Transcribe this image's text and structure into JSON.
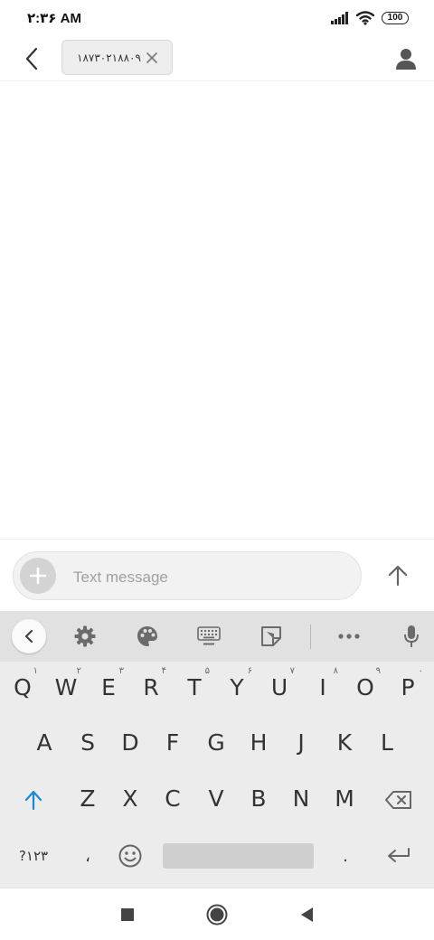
{
  "status_bar": {
    "time": "۲:۳۶ AM",
    "battery": "100"
  },
  "conversation": {
    "recipient": "۱۸۷۳۰۲۱۸۸۰۹"
  },
  "compose": {
    "placeholder": "Text message"
  },
  "keyboard": {
    "row1": [
      {
        "key": "Q",
        "hint": "۱"
      },
      {
        "key": "W",
        "hint": "۲"
      },
      {
        "key": "E",
        "hint": "۳"
      },
      {
        "key": "R",
        "hint": "۴"
      },
      {
        "key": "T",
        "hint": "۵"
      },
      {
        "key": "Y",
        "hint": "۶"
      },
      {
        "key": "U",
        "hint": "۷"
      },
      {
        "key": "I",
        "hint": "۸"
      },
      {
        "key": "O",
        "hint": "۹"
      },
      {
        "key": "P",
        "hint": "۰"
      }
    ],
    "row2": [
      "A",
      "S",
      "D",
      "F",
      "G",
      "H",
      "J",
      "K",
      "L"
    ],
    "row3": [
      "Z",
      "X",
      "C",
      "V",
      "B",
      "N",
      "M"
    ],
    "symbols_key": "?۱۲۳",
    "comma_key": "،",
    "period_key": "."
  },
  "icons": {
    "back": "back-arrow-icon",
    "chip_close": "close-icon",
    "contact": "person-icon",
    "attach": "plus-icon",
    "send": "arrow-up-icon",
    "toolbar": [
      "chevron-left-icon",
      "gear-icon",
      "palette-icon",
      "keyboard-icon",
      "sticker-icon",
      "more-icon",
      "mic-icon"
    ]
  },
  "colors": {
    "shift_accent": "#1a8ad8"
  }
}
